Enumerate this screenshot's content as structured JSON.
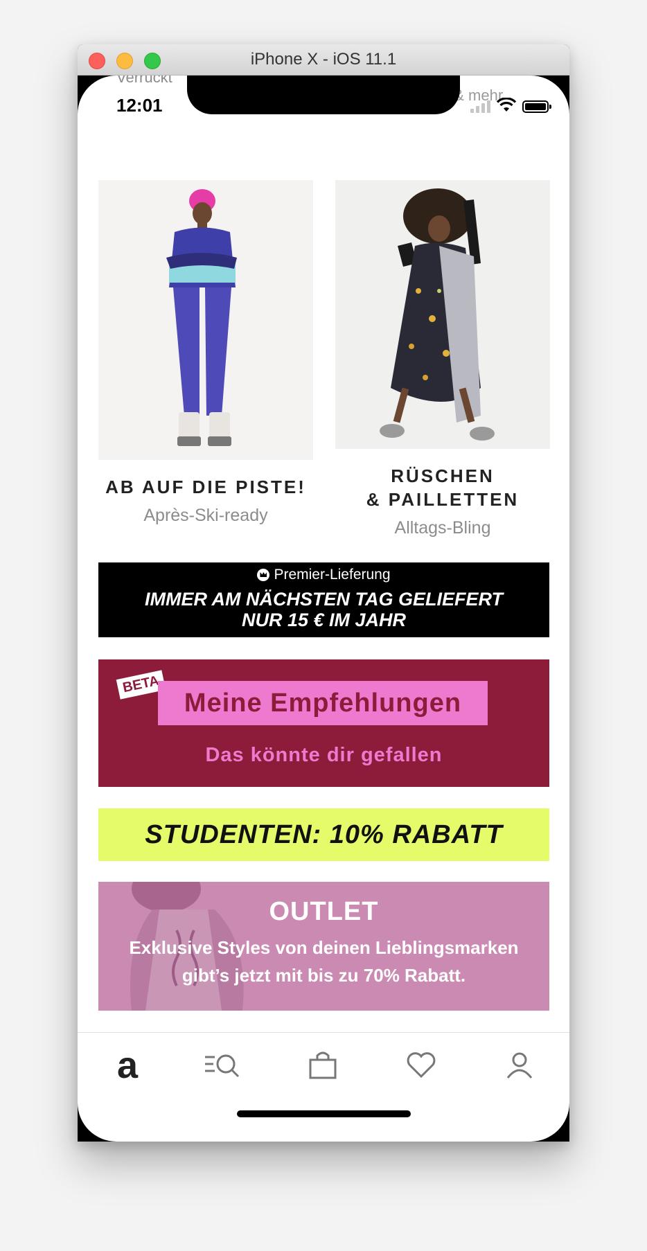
{
  "window": {
    "title": "iPhone X - iOS 11.1"
  },
  "status_bar": {
    "time": "12:01",
    "ghost_top": "Verrückt",
    "ghost_right": "el & mehr"
  },
  "tiles": [
    {
      "title": "AB AUF DIE PISTE!",
      "subtitle": "Après-Ski-ready"
    },
    {
      "title_line1": "RÜSCHEN",
      "title_line2": "& PAILLETTEN",
      "subtitle": "Alltags-Bling"
    }
  ],
  "premier": {
    "label": "Premier-Lieferung",
    "line1": "IMMER AM NÄCHSTEN TAG GELIEFERT",
    "line2": "NUR 15 €  IM JAHR"
  },
  "recommendations": {
    "badge": "BETA",
    "title": "Meine Empfehlungen",
    "subtitle": "Das könnte dir gefallen"
  },
  "students": {
    "text": "STUDENTEN: 10% RABATT"
  },
  "outlet": {
    "title": "OUTLET",
    "line1": "Exklusive Styles von deinen Lieblingsmarken",
    "line2": "gibt’s jetzt mit bis zu 70% Rabatt."
  },
  "tabbar": {
    "items": [
      {
        "icon": "asos-logo-icon",
        "label": "a"
      },
      {
        "icon": "search-icon"
      },
      {
        "icon": "bag-icon"
      },
      {
        "icon": "heart-icon"
      },
      {
        "icon": "profile-icon"
      }
    ]
  },
  "colors": {
    "burgundy": "#8c1c3a",
    "pink": "#ee7ad0",
    "lime": "#e6fb6a",
    "outlet": "#cb8ab2"
  }
}
